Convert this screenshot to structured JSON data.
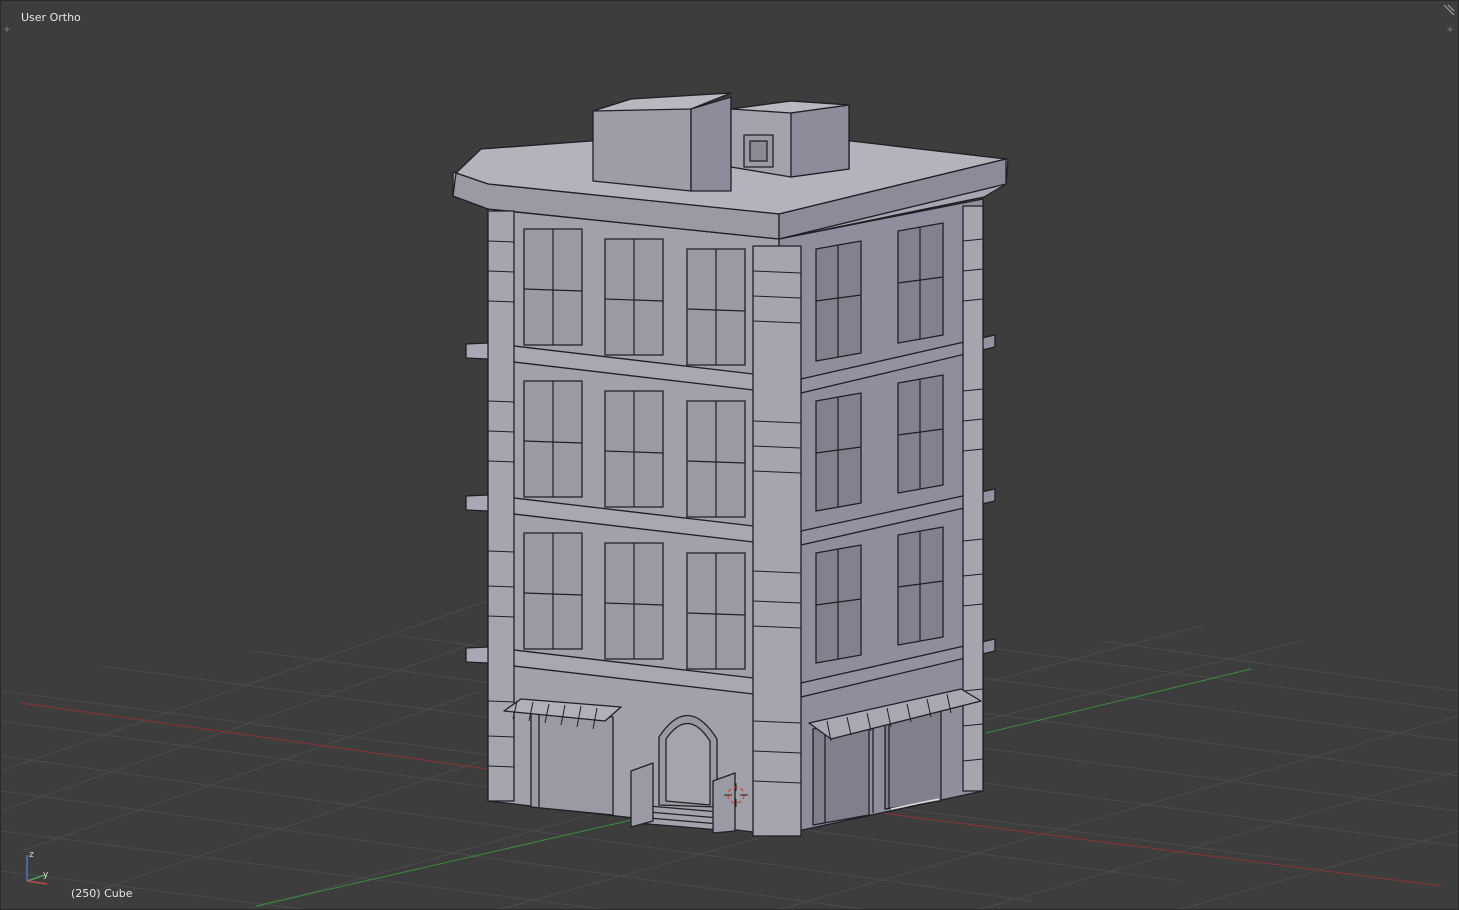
{
  "viewport": {
    "view_name": "User Ortho",
    "object_info": "(250) Cube"
  },
  "axes": {
    "x_color": "#b23c3c",
    "y_color": "#3c9c3c",
    "z_color": "#3c6cb2",
    "gizmo_labels": [
      "y",
      "z"
    ]
  },
  "colors": {
    "background": "#3d3d3d",
    "grid": "#4a4a4a",
    "building_front": "#9c9ca6",
    "building_side": "#8f8f9e",
    "wire": "#1e1e22"
  },
  "icons": {
    "corner_left": "plus-icon",
    "corner_right": "plus-icon",
    "cursor": "3d-cursor-icon"
  }
}
